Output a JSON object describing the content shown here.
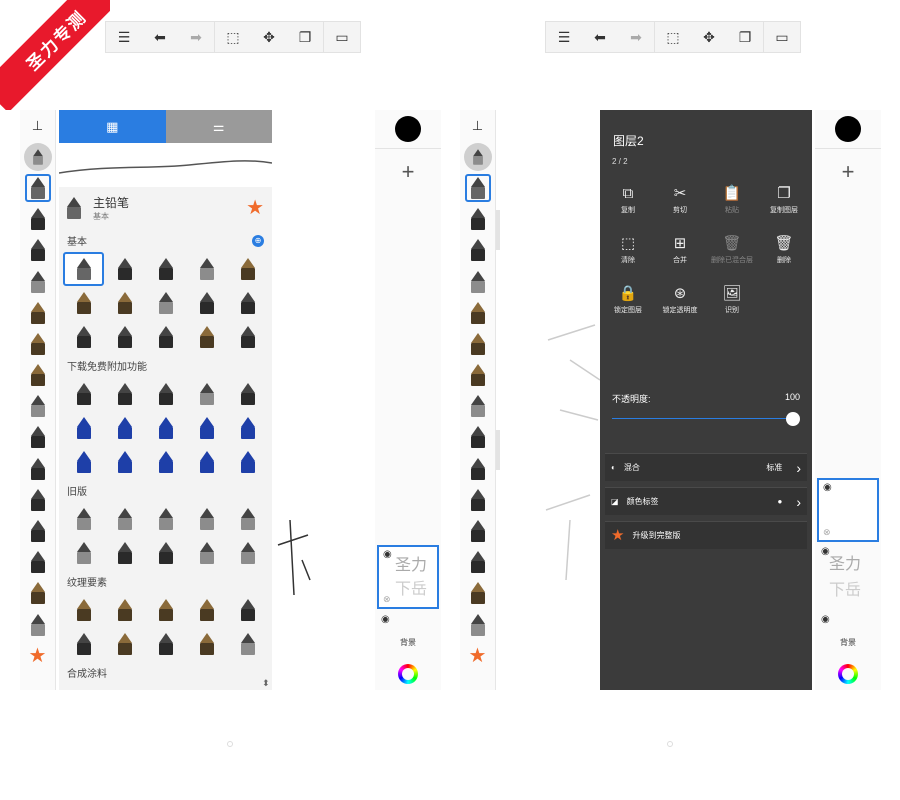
{
  "watermark": "圣力专测",
  "left_panel": {
    "toolbar_icons": [
      "list-icon",
      "undo-icon",
      "redo-icon",
      "select-icon",
      "move-icon",
      "layers-icon",
      "canvas-icon"
    ],
    "brush_library": {
      "selected_brush_name": "主铅笔",
      "selected_brush_sub": "基本",
      "sections": [
        {
          "title": "基本",
          "count": 15
        },
        {
          "title": "下载免费附加功能",
          "count": 15
        },
        {
          "title": "旧版",
          "count": 10
        },
        {
          "title": "纹理要素",
          "count": 10
        },
        {
          "title": "合成涂料",
          "count": 0
        }
      ]
    },
    "layers": {
      "background_label": "背景"
    }
  },
  "right_panel": {
    "layer_menu": {
      "title": "图层2",
      "page": "2 / 2",
      "actions": [
        {
          "label": "复制",
          "icon": "⧉"
        },
        {
          "label": "剪切",
          "icon": "✂"
        },
        {
          "label": "粘贴",
          "icon": "📋"
        },
        {
          "label": "复制图层",
          "icon": "❐"
        },
        {
          "label": "清除",
          "icon": "⬚"
        },
        {
          "label": "合并",
          "icon": "⊞"
        },
        {
          "label": "删除已混合层",
          "icon": "🗑"
        },
        {
          "label": "删除",
          "icon": "🗑"
        },
        {
          "label": "锁定图层",
          "icon": "🔒"
        },
        {
          "label": "锁定透明度",
          "icon": "⊛"
        },
        {
          "label": "识别",
          "icon": "🖼"
        }
      ],
      "opacity_label": "不透明度:",
      "opacity_value": "100",
      "opacity": 1.0,
      "blend_label": "混合",
      "blend_value": "标准",
      "color_label": "颜色标签",
      "upgrade_label": "升级到完整版"
    },
    "layers": {
      "background_label": "背景"
    }
  },
  "colors": {
    "accent": "#2a7de1",
    "star": "#f06b2b",
    "watermark_bg": "#e8192c"
  }
}
